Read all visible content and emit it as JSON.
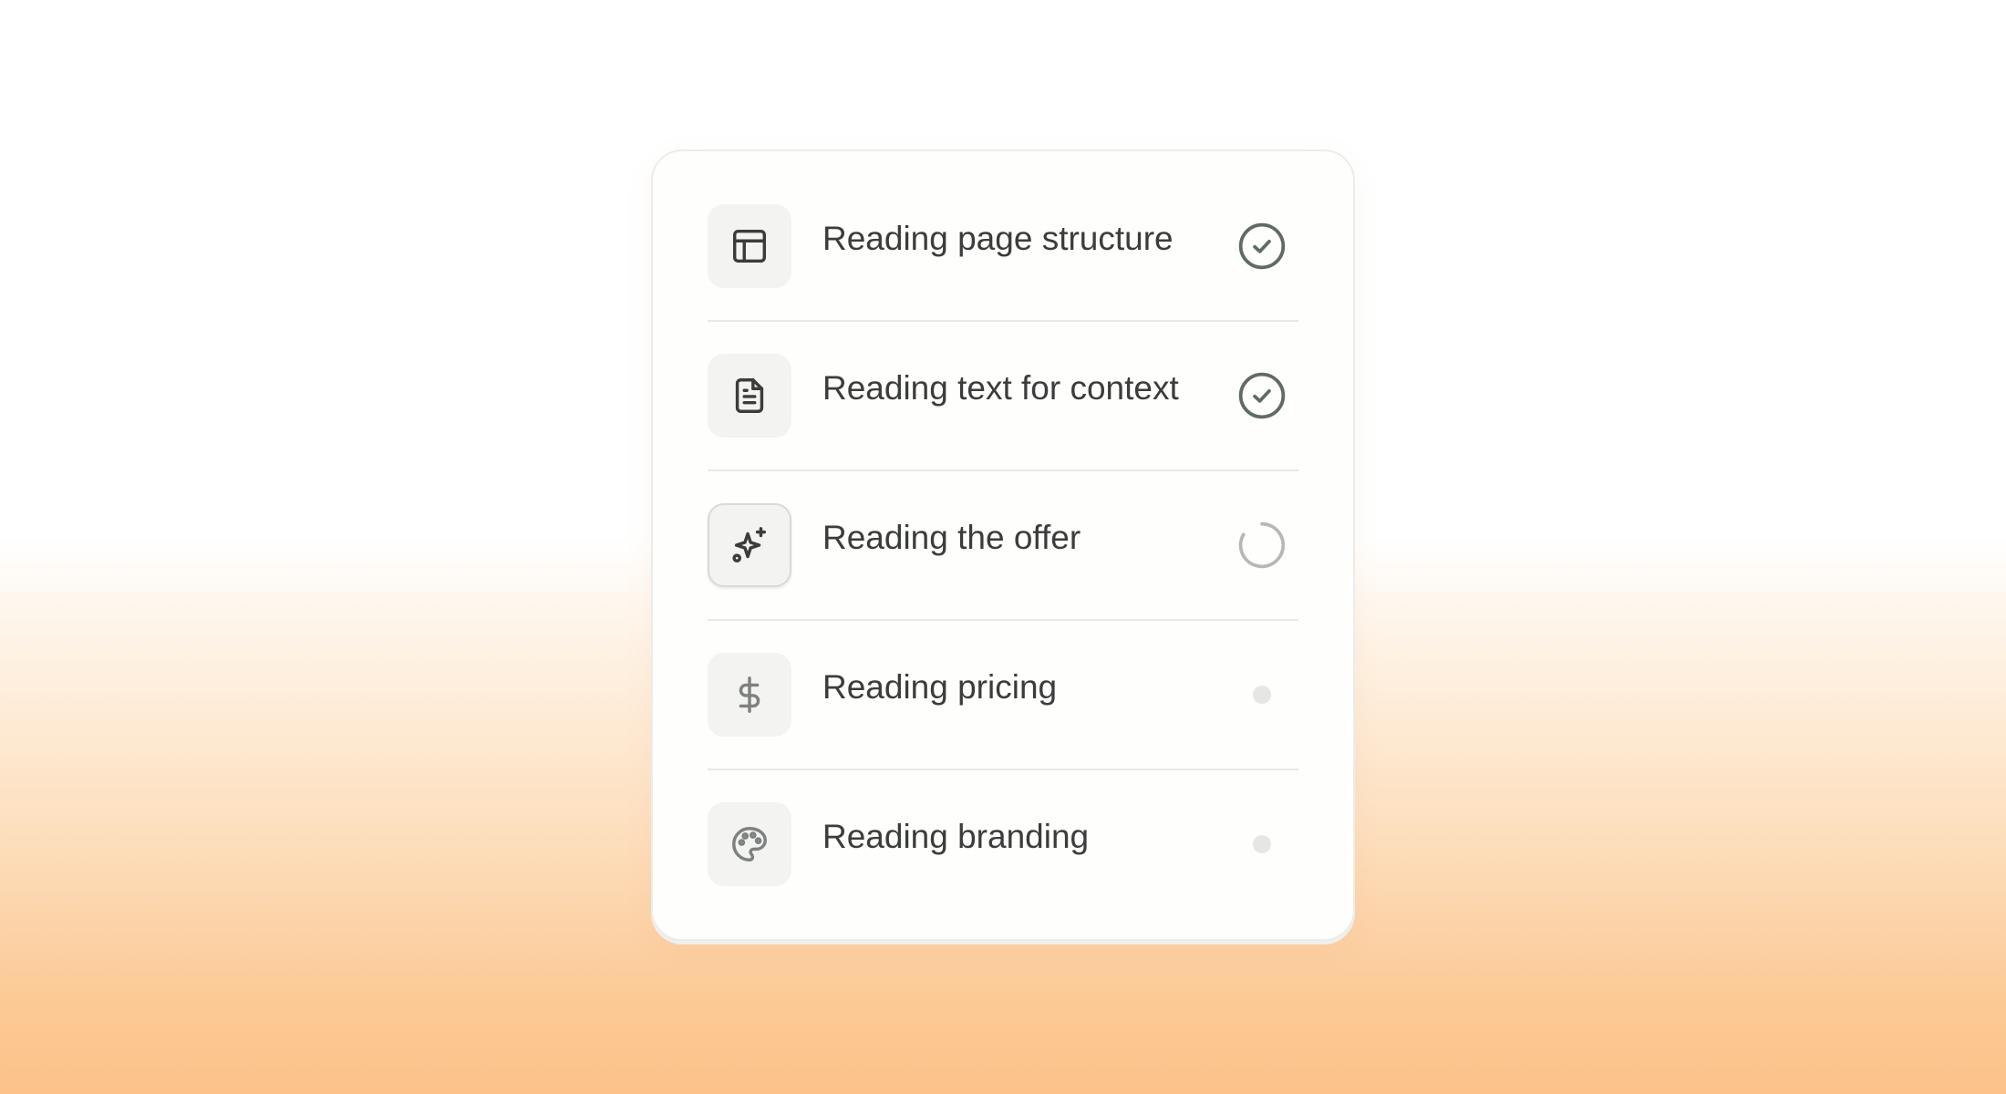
{
  "steps": [
    {
      "label": "Reading page structure",
      "icon": "layout-icon",
      "status": "done"
    },
    {
      "label": "Reading text for context",
      "icon": "document-icon",
      "status": "done"
    },
    {
      "label": "Reading the offer",
      "icon": "sparkles-icon",
      "status": "in-progress"
    },
    {
      "label": "Reading pricing",
      "icon": "dollar-icon",
      "status": "pending"
    },
    {
      "label": "Reading branding",
      "icon": "palette-icon",
      "status": "pending"
    }
  ],
  "colors": {
    "done": "#5f6b64",
    "spinner": "#b5b8b6",
    "pending": "#e6e6e3",
    "text": "#3a3d3b"
  }
}
